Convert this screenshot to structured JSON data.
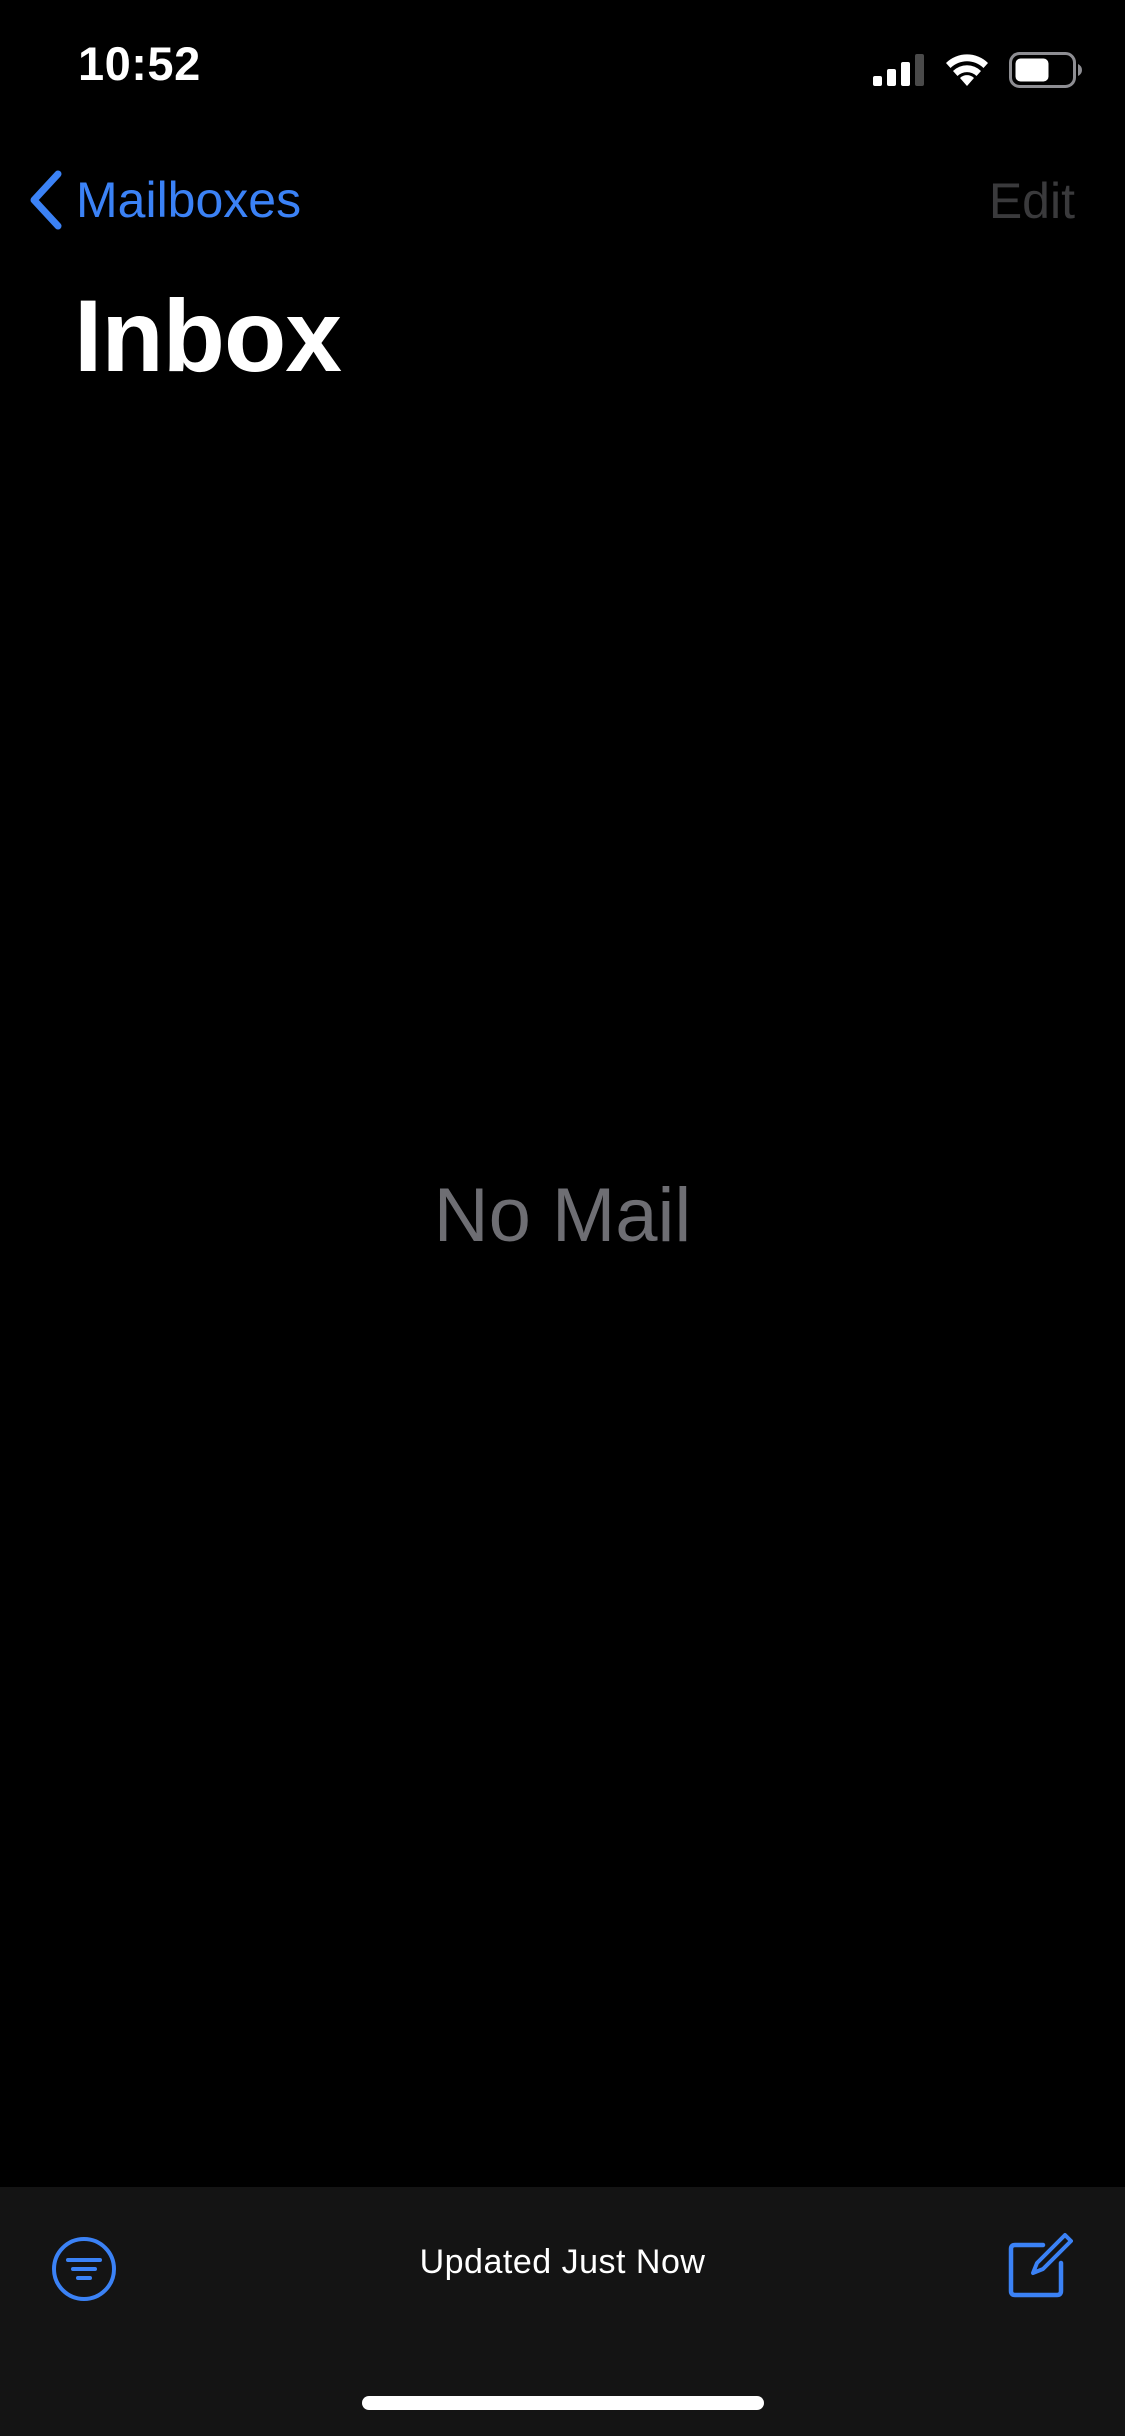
{
  "status_bar": {
    "time": "10:52",
    "icons": [
      "cellular-signal-icon",
      "wifi-icon",
      "battery-icon"
    ]
  },
  "nav": {
    "back_label": "Mailboxes",
    "edit_label": "Edit"
  },
  "title": "Inbox",
  "empty_state": "No Mail",
  "toolbar": {
    "status_text": "Updated Just Now",
    "filter_icon": "filter-icon",
    "compose_icon": "compose-icon"
  },
  "colors": {
    "background": "#000000",
    "accent": "#3b82f6",
    "toolbar_background": "#141414",
    "disabled_text": "#3a3a3c",
    "secondary_text": "#6e6e73"
  }
}
